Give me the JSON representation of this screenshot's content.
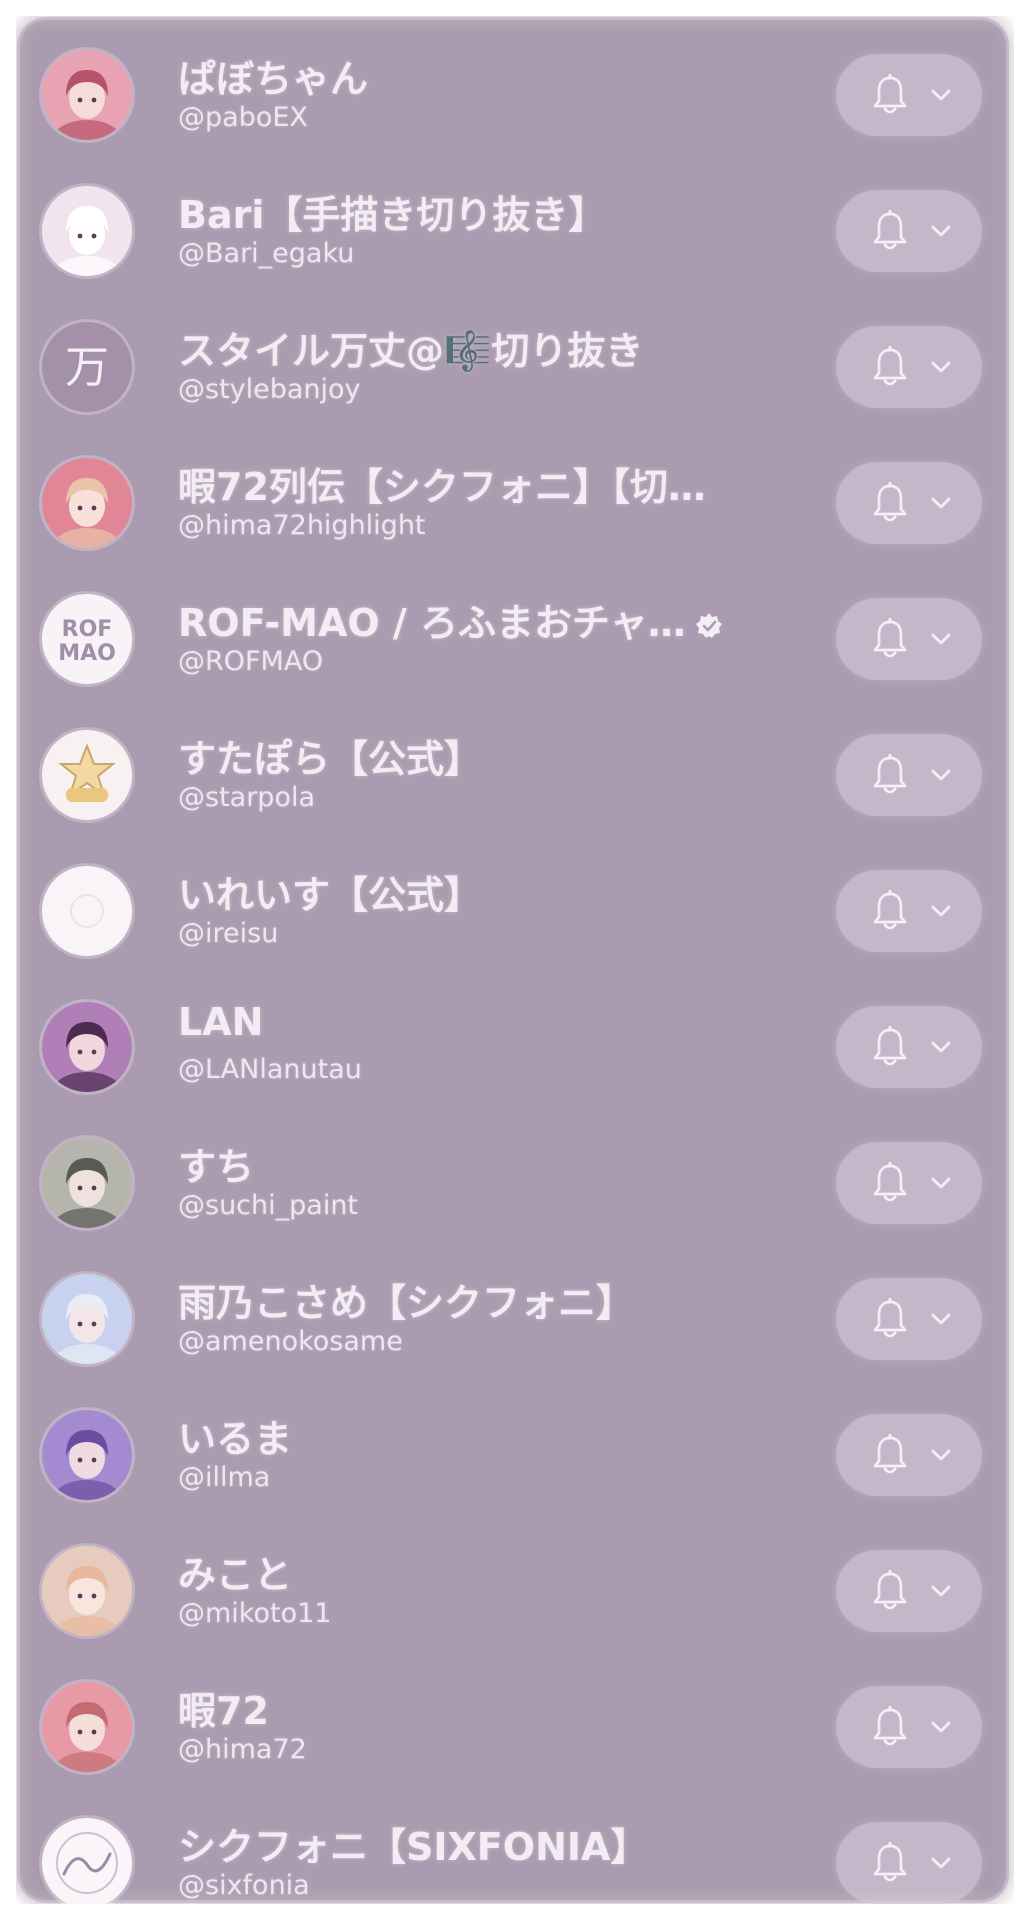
{
  "colors": {
    "panel": "#ab9bb0",
    "text": "#f3ecf4",
    "pill": "#cdbfd1"
  },
  "channels": [
    {
      "name": "ぱぼちゃん",
      "handle": "@paboEX",
      "avatar": "anime-avatar-red"
    },
    {
      "name": "Bari【手描き切り抜き】",
      "handle": "@Bari_egaku",
      "avatar": "cartoon-avatar-white"
    },
    {
      "name": "スタイル万丈@🎼切り抜き",
      "handle": "@stylebanjoy",
      "avatar": "kanji-avatar",
      "avatar_text": "万"
    },
    {
      "name": "暇72列伝【シクフォニ】【切…",
      "handle": "@hima72highlight",
      "avatar": "anime-avatar-pink"
    },
    {
      "name": "ROF-MAO / ろふまおチャ…",
      "handle": "@ROFMAO",
      "avatar": "logo-avatar",
      "avatar_text_1": "ROF",
      "avatar_text_2": "MAO",
      "verified": true
    },
    {
      "name": "すたぽら【公式】",
      "handle": "@starpola",
      "avatar": "star-logo-avatar"
    },
    {
      "name": "いれいす【公式】",
      "handle": "@ireisu",
      "avatar": "white-logo-avatar"
    },
    {
      "name": "LAN",
      "handle": "@LANlanutau",
      "avatar": "anime-avatar-purple"
    },
    {
      "name": "すち",
      "handle": "@suchi_paint",
      "avatar": "anime-avatar-green"
    },
    {
      "name": "雨乃こさめ【シクフォニ】",
      "handle": "@amenokosame",
      "avatar": "anime-avatar-blue"
    },
    {
      "name": "いるま",
      "handle": "@illma",
      "avatar": "anime-avatar-violet"
    },
    {
      "name": "みこと",
      "handle": "@mikoto11",
      "avatar": "anime-avatar-peach"
    },
    {
      "name": "暇72",
      "handle": "@hima72",
      "avatar": "anime-avatar-rose"
    },
    {
      "name": "シクフォニ【SIXFONIA】",
      "handle": "@sixfonia",
      "avatar": "script-logo-avatar"
    }
  ],
  "icons": {
    "notify": "bell-icon",
    "expand": "chevron-down-icon",
    "verified": "verified-badge-icon"
  }
}
